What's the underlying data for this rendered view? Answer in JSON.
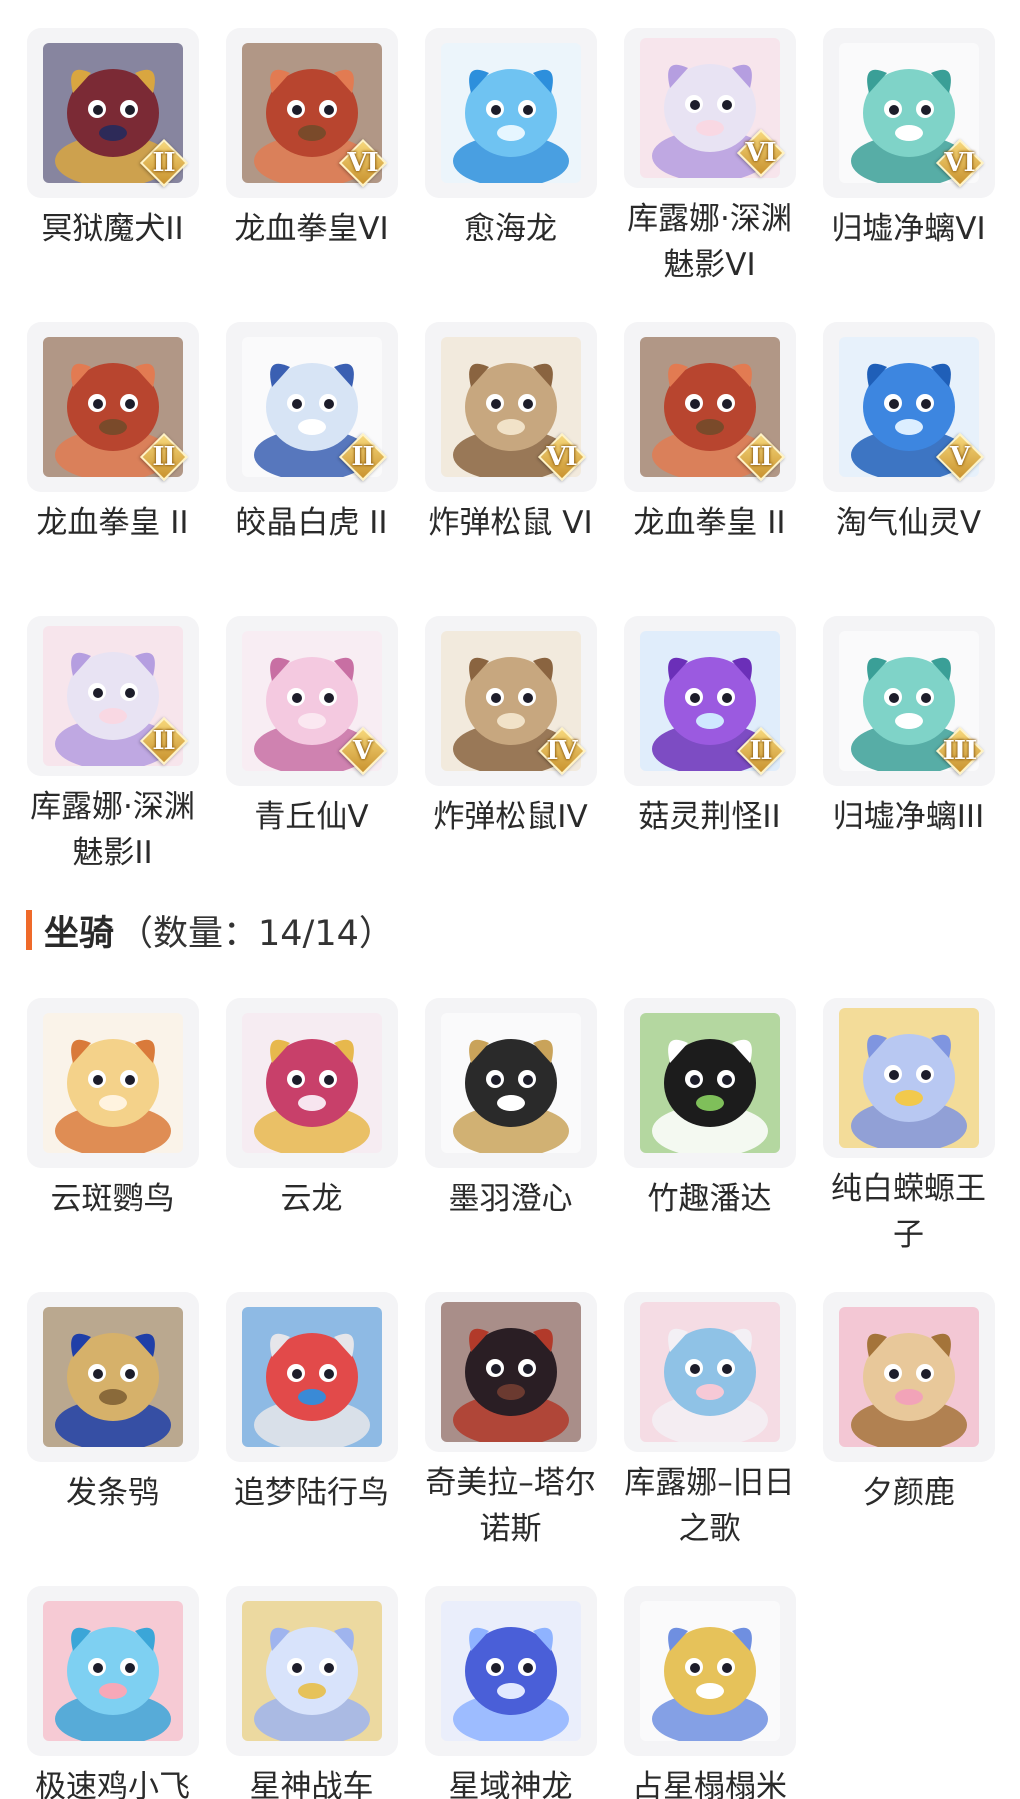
{
  "pets": [
    {
      "name": "冥狱魔犬II",
      "rank": "II",
      "icon": "dragon-dog-icon",
      "colors": [
        "#7b2a35",
        "#d9a640",
        "#2d2a58"
      ]
    },
    {
      "name": "龙血拳皇VI",
      "rank": "VI",
      "icon": "ram-beast-icon",
      "colors": [
        "#b8452f",
        "#e27b52",
        "#7a4a2a"
      ]
    },
    {
      "name": "愈海龙",
      "rank": "",
      "icon": "sea-dragon-icon",
      "colors": [
        "#6fc3f2",
        "#2d8fdc",
        "#e6f6ff"
      ]
    },
    {
      "name": "库露娜·深渊魅影VI",
      "rank": "VI",
      "icon": "fairy-girl-icon",
      "colors": [
        "#e8e3f3",
        "#b59ee0",
        "#f9d8e3"
      ]
    },
    {
      "name": "归墟净螭VI",
      "rank": "VI",
      "icon": "jade-dragon-icon",
      "colors": [
        "#7fd3c8",
        "#3a9f97",
        "#ffffff"
      ]
    },
    {
      "name": "龙血拳皇 II",
      "rank": "II",
      "icon": "ram-beast-icon",
      "colors": [
        "#b8452f",
        "#e27b52",
        "#7a4a2a"
      ]
    },
    {
      "name": "皎晶白虎 II",
      "rank": "II",
      "icon": "white-tiger-icon",
      "colors": [
        "#d7e4f5",
        "#3a5fb2",
        "#ffffff"
      ]
    },
    {
      "name": "炸弹松鼠 VI",
      "rank": "VI",
      "icon": "squirrel-icon",
      "colors": [
        "#c7a77f",
        "#8a6440",
        "#f1e2c8"
      ]
    },
    {
      "name": "龙血拳皇 II",
      "rank": "II",
      "icon": "ram-beast-icon",
      "colors": [
        "#b8452f",
        "#e27b52",
        "#7a4a2a"
      ]
    },
    {
      "name": "淘气仙灵V",
      "rank": "V",
      "icon": "blue-spirit-icon",
      "colors": [
        "#3d86e0",
        "#1f5fb8",
        "#dceeff"
      ]
    },
    {
      "name": "库露娜·深渊魅影II",
      "rank": "II",
      "icon": "fairy-girl-icon",
      "colors": [
        "#e8e3f3",
        "#b59ee0",
        "#f9d8e3"
      ]
    },
    {
      "name": "青丘仙V",
      "rank": "V",
      "icon": "fox-fairy-icon",
      "colors": [
        "#f4c9e0",
        "#c86fa3",
        "#fbe8f1"
      ]
    },
    {
      "name": "炸弹松鼠IV",
      "rank": "IV",
      "icon": "squirrel-icon",
      "colors": [
        "#c7a77f",
        "#8a6440",
        "#f1e2c8"
      ]
    },
    {
      "name": "菇灵荆怪II",
      "rank": "II",
      "icon": "mushroom-sprite-icon",
      "colors": [
        "#9b5ae0",
        "#6b2fb8",
        "#cfe8ff"
      ]
    },
    {
      "name": "归墟净螭III",
      "rank": "III",
      "icon": "jade-dragon-icon",
      "colors": [
        "#7fd3c8",
        "#3a9f97",
        "#ffffff"
      ]
    }
  ],
  "mounts_section": {
    "title": "坐骑",
    "count_text": "（数量：14/14）",
    "accent": "#ef6a2a"
  },
  "mounts": [
    {
      "name": "云斑鹦鸟",
      "icon": "parrot-icon",
      "colors": [
        "#f4d28a",
        "#d97a3a",
        "#fff3df"
      ]
    },
    {
      "name": "云龙",
      "icon": "cloud-dragon-icon",
      "colors": [
        "#c8406a",
        "#e7b84d",
        "#f7e5ef"
      ]
    },
    {
      "name": "墨羽澄心",
      "icon": "feather-staff-icon",
      "colors": [
        "#2a2a2a",
        "#c9a35a",
        "#ffffff"
      ]
    },
    {
      "name": "竹趣潘达",
      "icon": "panda-icon",
      "colors": [
        "#1c1c1c",
        "#ffffff",
        "#7fbf5a"
      ]
    },
    {
      "name": "纯白蝾螈王子",
      "icon": "axolotl-prince-icon",
      "colors": [
        "#b8c8f2",
        "#7f95e0",
        "#f2c94c"
      ]
    },
    {
      "name": "发条鸮",
      "icon": "clockwork-owl-icon",
      "colors": [
        "#d6b16a",
        "#1f3fa8",
        "#8a6a3a"
      ]
    },
    {
      "name": "追梦陆行鸟",
      "icon": "dream-bird-icon",
      "colors": [
        "#e24a4a",
        "#e6e6ea",
        "#3a8ad6"
      ]
    },
    {
      "name": "奇美拉–塔尔诺斯",
      "icon": "chimera-icon",
      "colors": [
        "#2a1e24",
        "#b23a2a",
        "#6b3a30"
      ]
    },
    {
      "name": "库露娜–旧日之歌",
      "icon": "curly-girl-icon",
      "colors": [
        "#8fc2e6",
        "#f3f0f5",
        "#f6c9d6"
      ]
    },
    {
      "name": "夕颜鹿",
      "icon": "blossom-deer-icon",
      "colors": [
        "#e8c89a",
        "#a4743a",
        "#f2a3b8"
      ]
    },
    {
      "name": "极速鸡小飞",
      "icon": "blue-chick-icon",
      "colors": [
        "#7ed0f2",
        "#3ba6d8",
        "#f7a8b8"
      ]
    },
    {
      "name": "星神战车",
      "icon": "star-horse-icon",
      "colors": [
        "#d8e3fb",
        "#9fb4ee",
        "#e6c25a"
      ]
    },
    {
      "name": "星域神龙",
      "icon": "galaxy-dragon-icon",
      "colors": [
        "#4a5fd8",
        "#8fb3ff",
        "#e2e9ff"
      ]
    },
    {
      "name": "占星榻榻米",
      "icon": "astro-lamp-icon",
      "colors": [
        "#e6c25a",
        "#6f8fe0",
        "#ffffff"
      ]
    }
  ]
}
